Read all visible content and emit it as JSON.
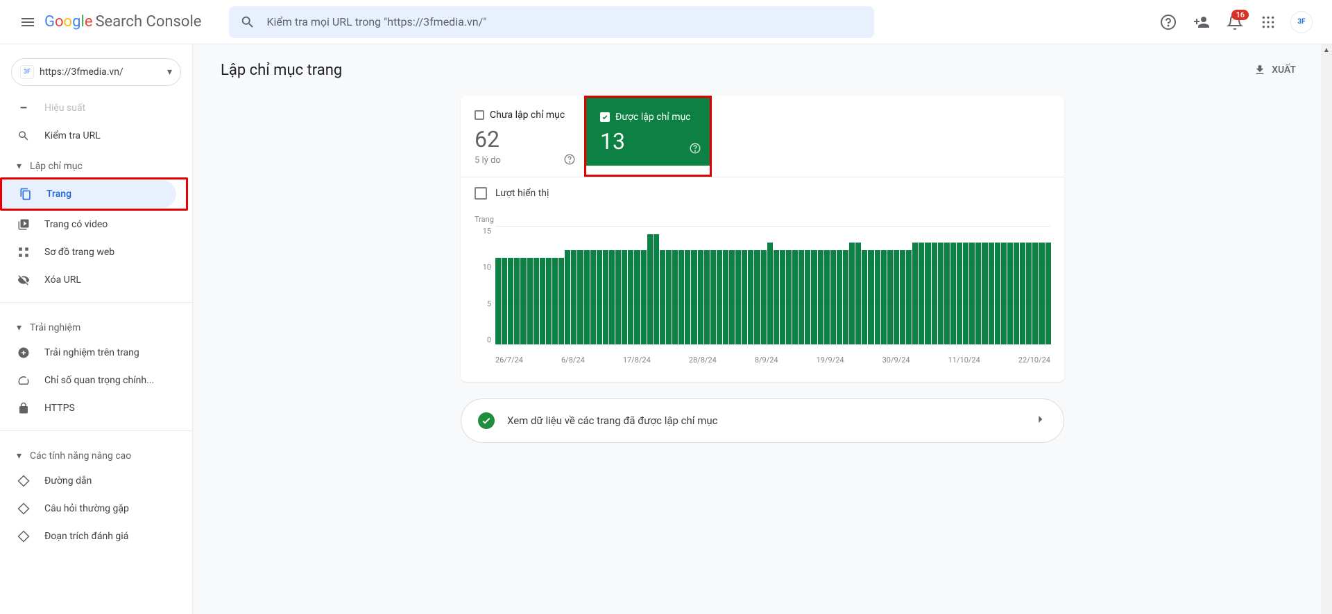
{
  "header": {
    "logo_google": "Google",
    "logo_product": "Search Console",
    "search_placeholder": "Kiểm tra mọi URL trong \"https://3fmedia.vn/\"",
    "notification_count": "16"
  },
  "sidebar": {
    "property": "https://3fmedia.vn/",
    "truncated_top": "Hiệu suất",
    "inspect_url": "Kiểm tra URL",
    "section_indexing": "Lập chỉ mục",
    "item_pages": "Trang",
    "item_video_pages": "Trang có video",
    "item_sitemaps": "Sơ đồ trang web",
    "item_removals": "Xóa URL",
    "section_experience": "Trải nghiệm",
    "item_page_experience": "Trải nghiệm trên trang",
    "item_cwv": "Chỉ số quan trọng chính...",
    "item_https": "HTTPS",
    "section_enhancements": "Các tính năng nâng cao",
    "item_breadcrumbs": "Đường dẫn",
    "item_faq": "Câu hỏi thường gặp",
    "item_review_snippet": "Đoạn trích đánh giá"
  },
  "page": {
    "title": "Lập chỉ mục trang",
    "export": "XUẤT"
  },
  "summary": {
    "not_indexed_label": "Chưa lập chỉ mục",
    "not_indexed_value": "62",
    "not_indexed_sub": "5 lý do",
    "indexed_label": "Được lập chỉ mục",
    "indexed_value": "13"
  },
  "impressions": {
    "label": "Lượt hiển thị"
  },
  "chart_data": {
    "type": "bar",
    "title": "Trang",
    "ylim": [
      0,
      15
    ],
    "yticks": [
      0,
      5,
      10,
      15
    ],
    "xticks": [
      "26/7/24",
      "6/8/24",
      "17/8/24",
      "28/8/24",
      "8/9/24",
      "19/9/24",
      "30/9/24",
      "11/10/24",
      "22/10/24"
    ],
    "values": [
      11,
      11,
      11,
      11,
      11,
      11,
      11,
      11,
      11,
      11,
      11,
      12,
      12,
      12,
      12,
      12,
      12,
      12,
      12,
      12,
      12,
      12,
      12,
      12,
      14,
      14,
      12,
      12,
      12,
      12,
      12,
      12,
      12,
      12,
      12,
      12,
      12,
      12,
      12,
      12,
      12,
      12,
      12,
      13,
      12,
      12,
      12,
      12,
      12,
      12,
      12,
      12,
      12,
      12,
      12,
      12,
      13,
      13,
      12,
      12,
      12,
      12,
      12,
      12,
      12,
      12,
      13,
      13,
      13,
      13,
      13,
      13,
      13,
      13,
      13,
      13,
      13,
      13,
      13,
      13,
      13,
      13,
      13,
      13,
      13,
      13,
      13,
      13
    ]
  },
  "link_card": {
    "text": "Xem dữ liệu về các trang đã được lập chỉ mục"
  }
}
